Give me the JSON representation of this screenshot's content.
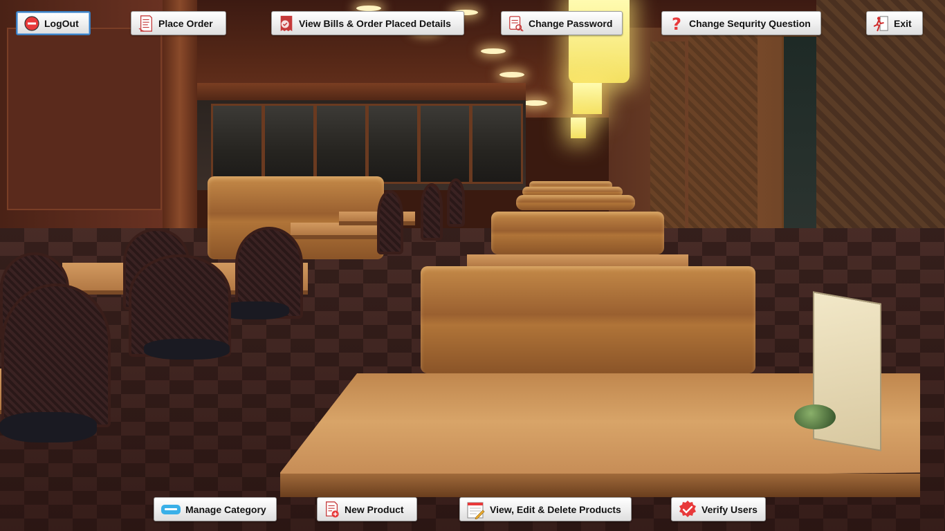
{
  "top_bar": {
    "logout": {
      "label": "LogOut",
      "icon": "power-icon"
    },
    "place_order": {
      "label": "Place Order",
      "icon": "receipt-icon"
    },
    "view_bills": {
      "label": "View Bills & Order Placed Details",
      "icon": "bill-icon"
    },
    "change_password": {
      "label": "Change Password",
      "icon": "lock-key-icon"
    },
    "change_security_question": {
      "label": "Change Sequrity Question",
      "icon": "question-icon"
    },
    "exit": {
      "label": "Exit",
      "icon": "exit-door-icon"
    }
  },
  "bottom_bar": {
    "manage_category": {
      "label": "Manage Category",
      "icon": "keyboard-icon"
    },
    "new_product": {
      "label": "New Product",
      "icon": "add-document-icon"
    },
    "view_edit_delete": {
      "label": "View, Edit & Delete Products",
      "icon": "edit-notepad-icon"
    },
    "verify_users": {
      "label": "Verify Users",
      "icon": "check-badge-icon"
    }
  },
  "colors": {
    "accent_red": "#e8393a",
    "button_focus_border": "#3c7fc1",
    "button_face": "#f0f0f0"
  }
}
